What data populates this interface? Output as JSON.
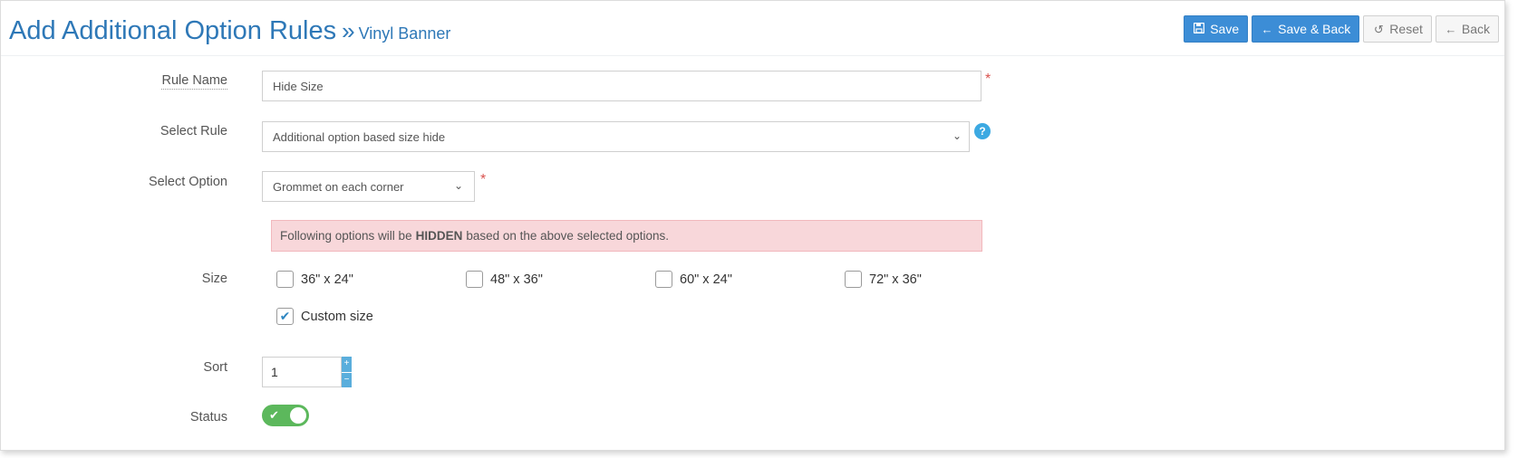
{
  "header": {
    "title": "Add Additional Option Rules",
    "separator": "»",
    "subtitle": "Vinyl Banner"
  },
  "actions": {
    "save": "Save",
    "save_back": "Save & Back",
    "reset": "Reset",
    "back": "Back"
  },
  "form": {
    "rule_name": {
      "label": "Rule Name",
      "value": "Hide Size",
      "required": "*"
    },
    "select_rule": {
      "label": "Select Rule",
      "value": "Additional option based size hide",
      "help": "?"
    },
    "select_option": {
      "label": "Select Option",
      "value": "Grommet on each corner",
      "required": "*"
    },
    "alert": {
      "prefix": "Following options will be",
      "emphasis": "HIDDEN",
      "suffix": "based on the above selected options."
    },
    "size": {
      "label": "Size",
      "options": [
        {
          "label": "36\" x 24\"",
          "checked": false
        },
        {
          "label": "48\" x 36\"",
          "checked": false
        },
        {
          "label": "60\" x 24\"",
          "checked": false
        },
        {
          "label": "72\" x 36\"",
          "checked": false
        },
        {
          "label": "Custom size",
          "checked": true
        }
      ]
    },
    "sort": {
      "label": "Sort",
      "value": "1"
    },
    "status": {
      "label": "Status",
      "enabled": true
    }
  },
  "colors": {
    "primary": "#3c8dd6",
    "title": "#2e78b7",
    "toggle_on": "#5cb85c",
    "alert_bg": "#f8d7da",
    "required": "#d9534f"
  }
}
